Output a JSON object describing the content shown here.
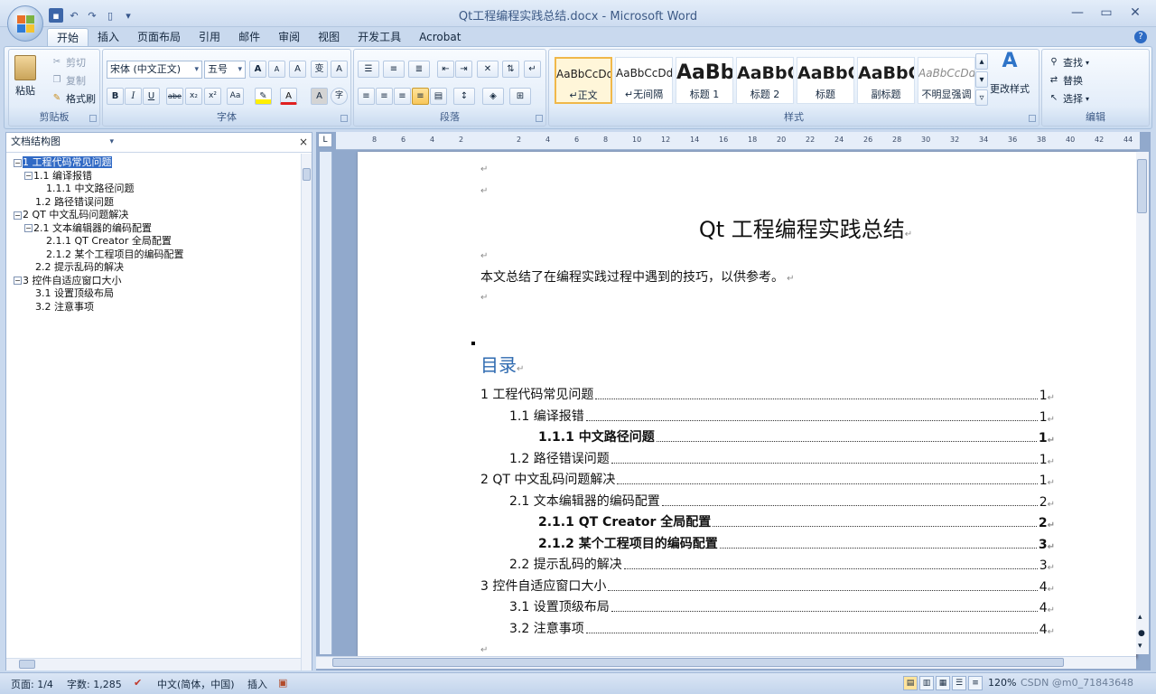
{
  "window": {
    "title": "Qt工程编程实践总结.docx - Microsoft Word",
    "minimize": "—",
    "maximize": "▭",
    "close": "✕"
  },
  "tabs": [
    "开始",
    "插入",
    "页面布局",
    "引用",
    "邮件",
    "审阅",
    "视图",
    "开发工具",
    "Acrobat"
  ],
  "active_tab": "开始",
  "ribbon": {
    "clipboard": {
      "label": "剪贴板",
      "paste": "粘贴",
      "cut": "剪切",
      "copy": "复制",
      "format_painter": "格式刷"
    },
    "font": {
      "label": "字体",
      "font_name": "宋体 (中文正文)",
      "font_size": "五号",
      "bold": "B",
      "italic": "I",
      "underline": "U",
      "strike": "abe",
      "subscript": "x₂",
      "superscript": "x²",
      "change_case": "Aa",
      "grow": "A",
      "shrink": "A",
      "clear": "A",
      "pinyin": "变",
      "border": "A",
      "shade": "A",
      "enclose": "字"
    },
    "paragraph": {
      "label": "段落"
    },
    "styles": {
      "label": "样式",
      "items": [
        {
          "preview": "AaBbCcDd",
          "name": "↵正文"
        },
        {
          "preview": "AaBbCcDd",
          "name": "↵无间隔"
        },
        {
          "preview": "AaBb",
          "name": "标题 1"
        },
        {
          "preview": "AaBbC",
          "name": "标题 2"
        },
        {
          "preview": "AaBbC",
          "name": "标题"
        },
        {
          "preview": "AaBbC",
          "name": "副标题"
        },
        {
          "preview": "AaBbCcDd",
          "name": "不明显强调"
        }
      ],
      "change_styles": "更改样式"
    },
    "editing": {
      "label": "编辑",
      "find": "查找",
      "replace": "替换",
      "select": "选择"
    }
  },
  "nav_pane": {
    "title": "文档结构图",
    "close": "×",
    "items": [
      {
        "text": "1  工程代码常见问题",
        "level": 0,
        "box": "−",
        "selected": true
      },
      {
        "text": "1.1 编译报错",
        "level": 1,
        "box": "−"
      },
      {
        "text": "1.1.1  中文路径问题",
        "level": 2
      },
      {
        "text": "1.2 路径错误问题",
        "level": 1
      },
      {
        "text": "2 QT 中文乱码问题解决",
        "level": 0,
        "box": "−"
      },
      {
        "text": "2.1 文本编辑器的编码配置",
        "level": 1,
        "box": "−"
      },
      {
        "text": "2.1.1  QT Creator 全局配置",
        "level": 2
      },
      {
        "text": "2.1.2  某个工程项目的编码配置",
        "level": 2
      },
      {
        "text": "2.2 提示乱码的解决",
        "level": 1
      },
      {
        "text": "3  控件自适应窗口大小",
        "level": 0,
        "box": "−"
      },
      {
        "text": "3.1 设置顶级布局",
        "level": 1
      },
      {
        "text": "3.2 注意事项",
        "level": 1
      }
    ]
  },
  "ruler": {
    "ticks": [
      "8",
      "6",
      "4",
      "2",
      "",
      "2",
      "4",
      "6",
      "8",
      "10",
      "12",
      "14",
      "16",
      "18",
      "20",
      "22",
      "24",
      "26",
      "28",
      "30",
      "32",
      "34",
      "36",
      "38",
      "40",
      "42",
      "44"
    ],
    "corner": "L"
  },
  "document": {
    "title": "Qt 工程编程实践总结",
    "intro": "本文总结了在编程实践过程中遇到的技巧，以供参考。",
    "toc_heading": "目录",
    "toc": [
      {
        "text": "1  工程代码常见问题",
        "page": "1",
        "indent": 0,
        "bold": false
      },
      {
        "text": "1.1 编译报错",
        "page": "1",
        "indent": 1,
        "bold": false
      },
      {
        "text": "1.1.1    中文路径问题",
        "page": "1",
        "indent": 2,
        "bold": true
      },
      {
        "text": "1.2 路径错误问题",
        "page": "1",
        "indent": 1,
        "bold": false
      },
      {
        "text": "2 QT 中文乱码问题解决",
        "page": "1",
        "indent": 0,
        "bold": false
      },
      {
        "text": "2.1 文本编辑器的编码配置",
        "page": "2",
        "indent": 1,
        "bold": false
      },
      {
        "text": "2.1.1    QT Creator 全局配置",
        "page": "2",
        "indent": 2,
        "bold": true
      },
      {
        "text": "2.1.2    某个工程项目的编码配置",
        "page": "3",
        "indent": 2,
        "bold": true
      },
      {
        "text": "2.2  提示乱码的解决",
        "page": "3",
        "indent": 1,
        "bold": false
      },
      {
        "text": "3    控件自适应窗口大小",
        "page": "4",
        "indent": 0,
        "bold": false
      },
      {
        "text": "3.1 设置顶级布局",
        "page": "4",
        "indent": 1,
        "bold": false
      },
      {
        "text": "3.2  注意事项",
        "page": "4",
        "indent": 1,
        "bold": false
      }
    ]
  },
  "status": {
    "page": "页面: 1/4",
    "words": "字数: 1,285",
    "language": "中文(简体，中国)",
    "insert": "插入",
    "zoom": "120%",
    "watermark": "CSDN @m0_71843648"
  },
  "colors": {
    "accent": "#2e6ab0",
    "selection": "#316ac5",
    "highlight": "#f0b84a"
  }
}
